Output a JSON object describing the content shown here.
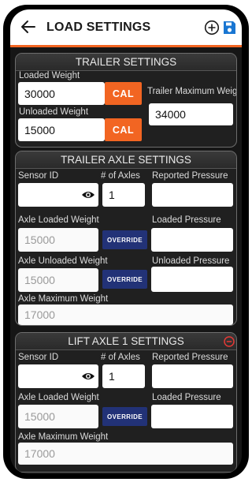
{
  "app_bar": {
    "title": "LOAD SETTINGS",
    "back_icon": "back-arrow-icon",
    "add_icon": "plus-circle-icon",
    "save_icon": "floppy-disk-icon",
    "accent_color": "#f26522",
    "save_icon_color": "#1976d2"
  },
  "trailer_settings": {
    "title": "TRAILER SETTINGS",
    "loaded_weight_label": "Loaded Weight",
    "loaded_weight_value": "30000",
    "loaded_cal_label": "CAL",
    "unloaded_weight_label": "Unloaded Weight",
    "unloaded_weight_value": "15000",
    "unloaded_cal_label": "CAL",
    "max_weight_label": "Trailer Maximum Weight",
    "max_weight_value": "34000"
  },
  "trailer_axle_settings": {
    "title": "TRAILER AXLE SETTINGS",
    "sensor_id_label": "Sensor ID",
    "sensor_id_value": "",
    "num_axles_label": "# of Axles",
    "num_axles_value": "1",
    "reported_pressure_label": "Reported Pressure",
    "reported_pressure_value": "",
    "axle_loaded_weight_label": "Axle Loaded Weight",
    "axle_loaded_weight_value": "15000",
    "loaded_override_label": "OVERRIDE",
    "loaded_pressure_label": "Loaded Pressure",
    "loaded_pressure_value": "",
    "axle_unloaded_weight_label": "Axle Unloaded Weight",
    "axle_unloaded_weight_value": "15000",
    "unloaded_override_label": "OVERRIDE",
    "unloaded_pressure_label": "Unloaded Pressure",
    "unloaded_pressure_value": "",
    "axle_max_weight_label": "Axle Maximum Weight",
    "axle_max_weight_value": "17000"
  },
  "lift_axle_1_settings": {
    "title": "LIFT AXLE 1 SETTINGS",
    "remove_icon": "minus-circle-icon",
    "remove_icon_color": "#e53935",
    "sensor_id_label": "Sensor ID",
    "sensor_id_value": "",
    "num_axles_label": "# of Axles",
    "num_axles_value": "1",
    "reported_pressure_label": "Reported Pressure",
    "reported_pressure_value": "",
    "axle_loaded_weight_label": "Axle Loaded Weight",
    "axle_loaded_weight_value": "15000",
    "loaded_override_label": "OVERRIDE",
    "loaded_pressure_label": "Loaded Pressure",
    "loaded_pressure_value": "",
    "axle_max_weight_label": "Axle Maximum Weight",
    "axle_max_weight_value": "17000"
  }
}
